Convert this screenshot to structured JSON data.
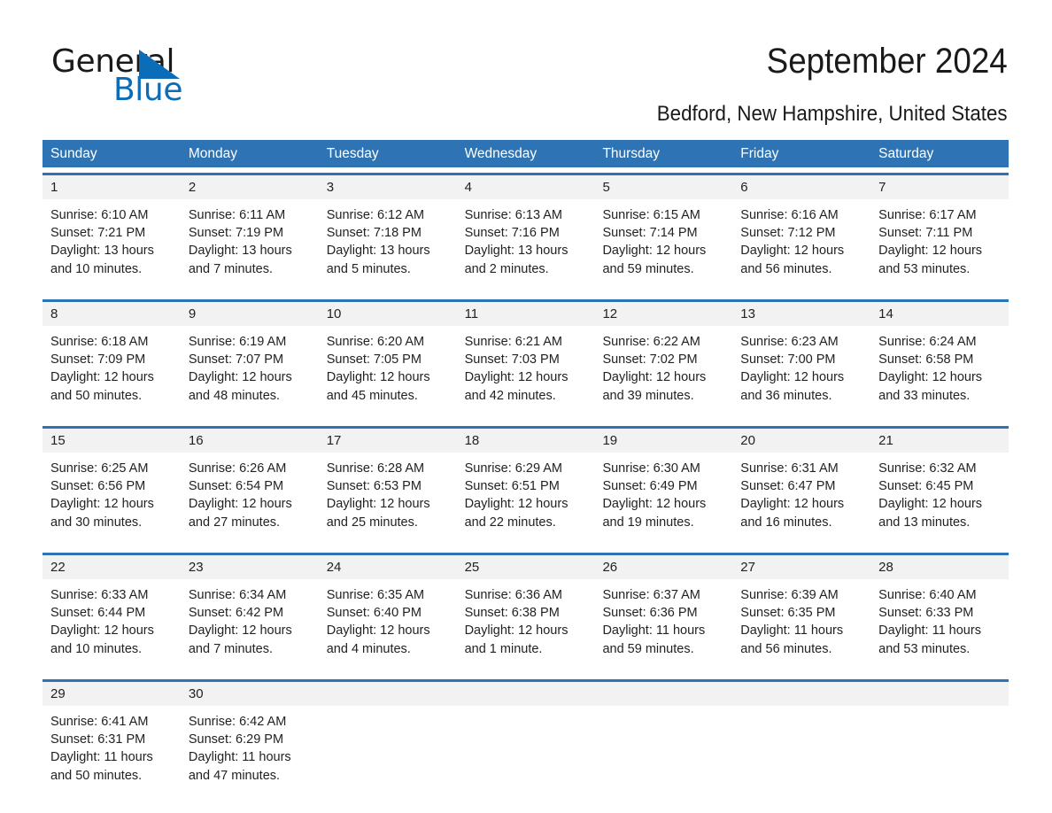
{
  "brand": {
    "name_part1": "General",
    "name_part2": "Blue",
    "triangle_color": "#0b6cb7",
    "blue_text_color": "#0b6cb7"
  },
  "header": {
    "title": "September 2024",
    "subtitle": "Bedford, New Hampshire, United States"
  },
  "colors": {
    "header_bar": "#2e74b5",
    "date_band": "#f2f2f2",
    "week_rule": "#2e74b5",
    "text": "#222222"
  },
  "weekdays": [
    "Sunday",
    "Monday",
    "Tuesday",
    "Wednesday",
    "Thursday",
    "Friday",
    "Saturday"
  ],
  "weeks": [
    {
      "days": [
        {
          "num": "1",
          "sunrise": "Sunrise: 6:10 AM",
          "sunset": "Sunset: 7:21 PM",
          "daylight1": "Daylight: 13 hours",
          "daylight2": "and 10 minutes."
        },
        {
          "num": "2",
          "sunrise": "Sunrise: 6:11 AM",
          "sunset": "Sunset: 7:19 PM",
          "daylight1": "Daylight: 13 hours",
          "daylight2": "and 7 minutes."
        },
        {
          "num": "3",
          "sunrise": "Sunrise: 6:12 AM",
          "sunset": "Sunset: 7:18 PM",
          "daylight1": "Daylight: 13 hours",
          "daylight2": "and 5 minutes."
        },
        {
          "num": "4",
          "sunrise": "Sunrise: 6:13 AM",
          "sunset": "Sunset: 7:16 PM",
          "daylight1": "Daylight: 13 hours",
          "daylight2": "and 2 minutes."
        },
        {
          "num": "5",
          "sunrise": "Sunrise: 6:15 AM",
          "sunset": "Sunset: 7:14 PM",
          "daylight1": "Daylight: 12 hours",
          "daylight2": "and 59 minutes."
        },
        {
          "num": "6",
          "sunrise": "Sunrise: 6:16 AM",
          "sunset": "Sunset: 7:12 PM",
          "daylight1": "Daylight: 12 hours",
          "daylight2": "and 56 minutes."
        },
        {
          "num": "7",
          "sunrise": "Sunrise: 6:17 AM",
          "sunset": "Sunset: 7:11 PM",
          "daylight1": "Daylight: 12 hours",
          "daylight2": "and 53 minutes."
        }
      ]
    },
    {
      "days": [
        {
          "num": "8",
          "sunrise": "Sunrise: 6:18 AM",
          "sunset": "Sunset: 7:09 PM",
          "daylight1": "Daylight: 12 hours",
          "daylight2": "and 50 minutes."
        },
        {
          "num": "9",
          "sunrise": "Sunrise: 6:19 AM",
          "sunset": "Sunset: 7:07 PM",
          "daylight1": "Daylight: 12 hours",
          "daylight2": "and 48 minutes."
        },
        {
          "num": "10",
          "sunrise": "Sunrise: 6:20 AM",
          "sunset": "Sunset: 7:05 PM",
          "daylight1": "Daylight: 12 hours",
          "daylight2": "and 45 minutes."
        },
        {
          "num": "11",
          "sunrise": "Sunrise: 6:21 AM",
          "sunset": "Sunset: 7:03 PM",
          "daylight1": "Daylight: 12 hours",
          "daylight2": "and 42 minutes."
        },
        {
          "num": "12",
          "sunrise": "Sunrise: 6:22 AM",
          "sunset": "Sunset: 7:02 PM",
          "daylight1": "Daylight: 12 hours",
          "daylight2": "and 39 minutes."
        },
        {
          "num": "13",
          "sunrise": "Sunrise: 6:23 AM",
          "sunset": "Sunset: 7:00 PM",
          "daylight1": "Daylight: 12 hours",
          "daylight2": "and 36 minutes."
        },
        {
          "num": "14",
          "sunrise": "Sunrise: 6:24 AM",
          "sunset": "Sunset: 6:58 PM",
          "daylight1": "Daylight: 12 hours",
          "daylight2": "and 33 minutes."
        }
      ]
    },
    {
      "days": [
        {
          "num": "15",
          "sunrise": "Sunrise: 6:25 AM",
          "sunset": "Sunset: 6:56 PM",
          "daylight1": "Daylight: 12 hours",
          "daylight2": "and 30 minutes."
        },
        {
          "num": "16",
          "sunrise": "Sunrise: 6:26 AM",
          "sunset": "Sunset: 6:54 PM",
          "daylight1": "Daylight: 12 hours",
          "daylight2": "and 27 minutes."
        },
        {
          "num": "17",
          "sunrise": "Sunrise: 6:28 AM",
          "sunset": "Sunset: 6:53 PM",
          "daylight1": "Daylight: 12 hours",
          "daylight2": "and 25 minutes."
        },
        {
          "num": "18",
          "sunrise": "Sunrise: 6:29 AM",
          "sunset": "Sunset: 6:51 PM",
          "daylight1": "Daylight: 12 hours",
          "daylight2": "and 22 minutes."
        },
        {
          "num": "19",
          "sunrise": "Sunrise: 6:30 AM",
          "sunset": "Sunset: 6:49 PM",
          "daylight1": "Daylight: 12 hours",
          "daylight2": "and 19 minutes."
        },
        {
          "num": "20",
          "sunrise": "Sunrise: 6:31 AM",
          "sunset": "Sunset: 6:47 PM",
          "daylight1": "Daylight: 12 hours",
          "daylight2": "and 16 minutes."
        },
        {
          "num": "21",
          "sunrise": "Sunrise: 6:32 AM",
          "sunset": "Sunset: 6:45 PM",
          "daylight1": "Daylight: 12 hours",
          "daylight2": "and 13 minutes."
        }
      ]
    },
    {
      "days": [
        {
          "num": "22",
          "sunrise": "Sunrise: 6:33 AM",
          "sunset": "Sunset: 6:44 PM",
          "daylight1": "Daylight: 12 hours",
          "daylight2": "and 10 minutes."
        },
        {
          "num": "23",
          "sunrise": "Sunrise: 6:34 AM",
          "sunset": "Sunset: 6:42 PM",
          "daylight1": "Daylight: 12 hours",
          "daylight2": "and 7 minutes."
        },
        {
          "num": "24",
          "sunrise": "Sunrise: 6:35 AM",
          "sunset": "Sunset: 6:40 PM",
          "daylight1": "Daylight: 12 hours",
          "daylight2": "and 4 minutes."
        },
        {
          "num": "25",
          "sunrise": "Sunrise: 6:36 AM",
          "sunset": "Sunset: 6:38 PM",
          "daylight1": "Daylight: 12 hours",
          "daylight2": "and 1 minute."
        },
        {
          "num": "26",
          "sunrise": "Sunrise: 6:37 AM",
          "sunset": "Sunset: 6:36 PM",
          "daylight1": "Daylight: 11 hours",
          "daylight2": "and 59 minutes."
        },
        {
          "num": "27",
          "sunrise": "Sunrise: 6:39 AM",
          "sunset": "Sunset: 6:35 PM",
          "daylight1": "Daylight: 11 hours",
          "daylight2": "and 56 minutes."
        },
        {
          "num": "28",
          "sunrise": "Sunrise: 6:40 AM",
          "sunset": "Sunset: 6:33 PM",
          "daylight1": "Daylight: 11 hours",
          "daylight2": "and 53 minutes."
        }
      ]
    },
    {
      "days": [
        {
          "num": "29",
          "sunrise": "Sunrise: 6:41 AM",
          "sunset": "Sunset: 6:31 PM",
          "daylight1": "Daylight: 11 hours",
          "daylight2": "and 50 minutes."
        },
        {
          "num": "30",
          "sunrise": "Sunrise: 6:42 AM",
          "sunset": "Sunset: 6:29 PM",
          "daylight1": "Daylight: 11 hours",
          "daylight2": "and 47 minutes."
        },
        {
          "num": "",
          "sunrise": "",
          "sunset": "",
          "daylight1": "",
          "daylight2": ""
        },
        {
          "num": "",
          "sunrise": "",
          "sunset": "",
          "daylight1": "",
          "daylight2": ""
        },
        {
          "num": "",
          "sunrise": "",
          "sunset": "",
          "daylight1": "",
          "daylight2": ""
        },
        {
          "num": "",
          "sunrise": "",
          "sunset": "",
          "daylight1": "",
          "daylight2": ""
        },
        {
          "num": "",
          "sunrise": "",
          "sunset": "",
          "daylight1": "",
          "daylight2": ""
        }
      ]
    }
  ]
}
